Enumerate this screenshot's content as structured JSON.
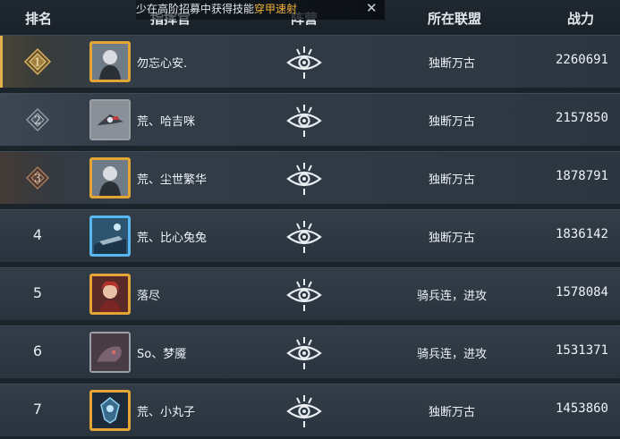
{
  "header": {
    "rank": "排名",
    "commander": "指挥官",
    "faction": "阵营",
    "alliance": "所在联盟",
    "power": "战力"
  },
  "toast": {
    "prefix": "少在高阶招募中获得技能",
    "highlight": "穿甲速射",
    "close": "✕"
  },
  "rows": [
    {
      "rank": "1",
      "name": "勿忘心安.",
      "alliance": "独断万古",
      "power": "2260691"
    },
    {
      "rank": "2",
      "name": "荒、哈吉咪",
      "alliance": "独断万古",
      "power": "2157850"
    },
    {
      "rank": "3",
      "name": "荒、尘世繁华",
      "alliance": "独断万古",
      "power": "1878791"
    },
    {
      "rank": "4",
      "name": "荒、比心兔兔",
      "alliance": "独断万古",
      "power": "1836142"
    },
    {
      "rank": "5",
      "name": "落尽",
      "alliance": "骑兵连，进攻",
      "power": "1578084"
    },
    {
      "rank": "6",
      "name": "So、梦魇",
      "alliance": "骑兵连，进攻",
      "power": "1531371"
    },
    {
      "rank": "7",
      "name": "荒、小丸子",
      "alliance": "独断万古",
      "power": "1453860"
    }
  ],
  "icons": {
    "faction": "faction-eye-emblem-icon",
    "medal_gold": "gold-rank-medal-icon",
    "medal_silver": "silver-rank-medal-icon",
    "medal_bronze": "bronze-rank-medal-icon"
  },
  "colors": {
    "accent_gold": "#e3a535",
    "frame_blue": "#58b7f0",
    "toast_highlight": "#f2b23a",
    "faction_icon": "#e9eef2"
  }
}
